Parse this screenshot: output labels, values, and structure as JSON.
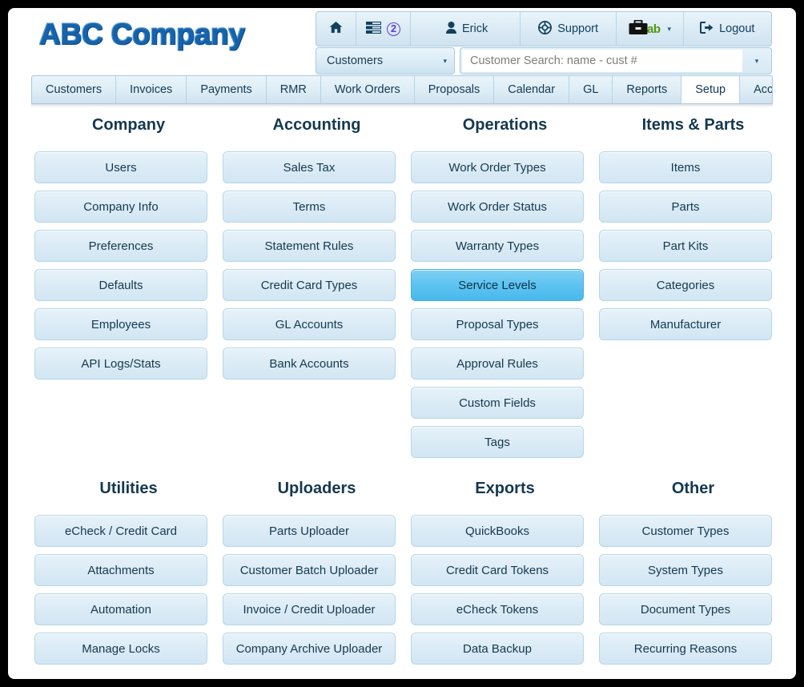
{
  "brand": {
    "logo_text": "ABC Company",
    "logo_color": "#1763ab"
  },
  "utilbar": {
    "home_icon": "home-icon",
    "tasks_icon": "task-list-icon",
    "tasks_badge": "2",
    "user_icon": "person-icon",
    "user_label": "Erick",
    "support_icon": "lifebuoy-icon",
    "support_label": "Support",
    "briefcase_icon": "briefcase-icon",
    "briefcase_label": "ab",
    "briefcase_caret": "▾",
    "logout_icon": "logout-icon",
    "logout_label": "Logout"
  },
  "search": {
    "scope_value": "Customers",
    "scope_caret": "▾",
    "placeholder": "Customer Search: name - cust #",
    "value": "",
    "dropdown_caret": "▾"
  },
  "tabs": [
    {
      "label": "Customers",
      "active": false
    },
    {
      "label": "Invoices",
      "active": false
    },
    {
      "label": "Payments",
      "active": false
    },
    {
      "label": "RMR",
      "active": false
    },
    {
      "label": "Work Orders",
      "active": false
    },
    {
      "label": "Proposals",
      "active": false
    },
    {
      "label": "Calendar",
      "active": false
    },
    {
      "label": "GL",
      "active": false
    },
    {
      "label": "Reports",
      "active": false
    },
    {
      "label": "Setup",
      "active": true
    },
    {
      "label": "Accounting ▾",
      "active": false
    }
  ],
  "columns_top": [
    {
      "heading": "Company",
      "buttons": [
        {
          "label": "Users",
          "selected": false
        },
        {
          "label": "Company Info",
          "selected": false
        },
        {
          "label": "Preferences",
          "selected": false
        },
        {
          "label": "Defaults",
          "selected": false
        },
        {
          "label": "Employees",
          "selected": false
        },
        {
          "label": "API Logs/Stats",
          "selected": false
        }
      ]
    },
    {
      "heading": "Accounting",
      "buttons": [
        {
          "label": "Sales Tax",
          "selected": false
        },
        {
          "label": "Terms",
          "selected": false
        },
        {
          "label": "Statement Rules",
          "selected": false
        },
        {
          "label": "Credit Card Types",
          "selected": false
        },
        {
          "label": "GL Accounts",
          "selected": false
        },
        {
          "label": "Bank Accounts",
          "selected": false
        }
      ]
    },
    {
      "heading": "Operations",
      "buttons": [
        {
          "label": "Work Order Types",
          "selected": false
        },
        {
          "label": "Work Order Status",
          "selected": false
        },
        {
          "label": "Warranty Types",
          "selected": false
        },
        {
          "label": "Service Levels",
          "selected": true
        },
        {
          "label": "Proposal Types",
          "selected": false
        },
        {
          "label": "Approval Rules",
          "selected": false
        },
        {
          "label": "Custom Fields",
          "selected": false
        },
        {
          "label": "Tags",
          "selected": false
        }
      ]
    },
    {
      "heading": "Items & Parts",
      "buttons": [
        {
          "label": "Items",
          "selected": false
        },
        {
          "label": "Parts",
          "selected": false
        },
        {
          "label": "Part Kits",
          "selected": false
        },
        {
          "label": "Categories",
          "selected": false
        },
        {
          "label": "Manufacturer",
          "selected": false
        }
      ]
    }
  ],
  "columns_bottom": [
    {
      "heading": "Utilities",
      "buttons": [
        {
          "label": "eCheck / Credit Card",
          "selected": false
        },
        {
          "label": "Attachments",
          "selected": false
        },
        {
          "label": "Automation",
          "selected": false
        },
        {
          "label": "Manage Locks",
          "selected": false
        }
      ]
    },
    {
      "heading": "Uploaders",
      "buttons": [
        {
          "label": "Parts Uploader",
          "selected": false
        },
        {
          "label": "Customer Batch Uploader",
          "selected": false
        },
        {
          "label": "Invoice / Credit Uploader",
          "selected": false
        },
        {
          "label": "Company Archive Uploader",
          "selected": false
        }
      ]
    },
    {
      "heading": "Exports",
      "buttons": [
        {
          "label": "QuickBooks",
          "selected": false
        },
        {
          "label": "Credit Card Tokens",
          "selected": false
        },
        {
          "label": "eCheck Tokens",
          "selected": false
        },
        {
          "label": "Data Backup",
          "selected": false
        }
      ]
    },
    {
      "heading": "Other",
      "buttons": [
        {
          "label": "Customer Types",
          "selected": false
        },
        {
          "label": "System Types",
          "selected": false
        },
        {
          "label": "Document Types",
          "selected": false
        },
        {
          "label": "Recurring Reasons",
          "selected": false
        }
      ]
    }
  ]
}
